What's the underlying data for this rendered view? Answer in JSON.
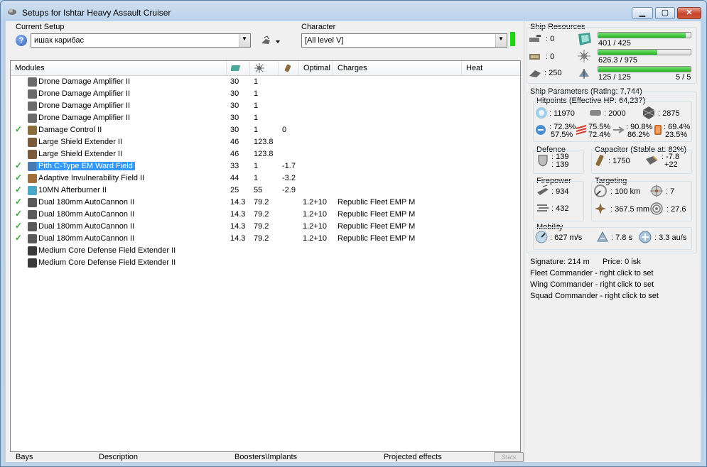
{
  "window": {
    "title": "Setups for Ishtar Heavy Assault Cruiser",
    "min_glyph": "▁",
    "max_glyph": "▢",
    "close_glyph": "✕"
  },
  "setup": {
    "label": "Current Setup",
    "value": "ишак карибас",
    "help_glyph": "?"
  },
  "character": {
    "label": "Character",
    "value": "[All level V]"
  },
  "modules": {
    "headers": {
      "modules": "Modules",
      "optimal": "Optimal",
      "charges": "Charges",
      "heat": "Heat"
    },
    "rows": [
      {
        "checked": false,
        "icon": "drone-damage-amplifier-icon",
        "name": "Drone Damage Amplifier II",
        "cpu": "30",
        "pg": "1",
        "cap": "",
        "optimal": "",
        "charges": "",
        "selected": false
      },
      {
        "checked": false,
        "icon": "drone-damage-amplifier-icon",
        "name": "Drone Damage Amplifier II",
        "cpu": "30",
        "pg": "1",
        "cap": "",
        "optimal": "",
        "charges": "",
        "selected": false
      },
      {
        "checked": false,
        "icon": "drone-damage-amplifier-icon",
        "name": "Drone Damage Amplifier II",
        "cpu": "30",
        "pg": "1",
        "cap": "",
        "optimal": "",
        "charges": "",
        "selected": false
      },
      {
        "checked": false,
        "icon": "drone-damage-amplifier-icon",
        "name": "Drone Damage Amplifier II",
        "cpu": "30",
        "pg": "1",
        "cap": "",
        "optimal": "",
        "charges": "",
        "selected": false
      },
      {
        "checked": true,
        "icon": "damage-control-icon",
        "name": "Damage Control II",
        "cpu": "30",
        "pg": "1",
        "cap": "0",
        "optimal": "",
        "charges": "",
        "selected": false
      },
      {
        "checked": false,
        "icon": "shield-extender-icon",
        "name": "Large Shield Extender II",
        "cpu": "46",
        "pg": "123.8",
        "cap": "",
        "optimal": "",
        "charges": "",
        "selected": false
      },
      {
        "checked": false,
        "icon": "shield-extender-icon",
        "name": "Large Shield Extender II",
        "cpu": "46",
        "pg": "123.8",
        "cap": "",
        "optimal": "",
        "charges": "",
        "selected": false
      },
      {
        "checked": true,
        "icon": "ward-field-icon",
        "name": "Pith C-Type EM Ward Field",
        "cpu": "33",
        "pg": "1",
        "cap": "-1.7",
        "optimal": "",
        "charges": "",
        "selected": true
      },
      {
        "checked": true,
        "icon": "invulnerability-field-icon",
        "name": "Adaptive Invulnerability Field II",
        "cpu": "44",
        "pg": "1",
        "cap": "-3.2",
        "optimal": "",
        "charges": "",
        "selected": false
      },
      {
        "checked": true,
        "icon": "afterburner-icon",
        "name": "10MN Afterburner II",
        "cpu": "25",
        "pg": "55",
        "cap": "-2.9",
        "optimal": "",
        "charges": "",
        "selected": false
      },
      {
        "checked": true,
        "icon": "autocannon-icon",
        "name": "Dual 180mm AutoCannon II",
        "cpu": "14.3",
        "pg": "79.2",
        "cap": "",
        "optimal": "1.2+10",
        "charges": "Republic Fleet EMP M",
        "selected": false
      },
      {
        "checked": true,
        "icon": "autocannon-icon",
        "name": "Dual 180mm AutoCannon II",
        "cpu": "14.3",
        "pg": "79.2",
        "cap": "",
        "optimal": "1.2+10",
        "charges": "Republic Fleet EMP M",
        "selected": false
      },
      {
        "checked": true,
        "icon": "autocannon-icon",
        "name": "Dual 180mm AutoCannon II",
        "cpu": "14.3",
        "pg": "79.2",
        "cap": "",
        "optimal": "1.2+10",
        "charges": "Republic Fleet EMP M",
        "selected": false
      },
      {
        "checked": true,
        "icon": "autocannon-icon",
        "name": "Dual 180mm AutoCannon II",
        "cpu": "14.3",
        "pg": "79.2",
        "cap": "",
        "optimal": "1.2+10",
        "charges": "Republic Fleet EMP M",
        "selected": false
      },
      {
        "checked": false,
        "icon": "rig-icon",
        "name": "Medium Core Defense Field Extender II",
        "cpu": "",
        "pg": "",
        "cap": "",
        "optimal": "",
        "charges": "",
        "selected": false
      },
      {
        "checked": false,
        "icon": "rig-icon",
        "name": "Medium Core Defense Field Extender II",
        "cpu": "",
        "pg": "",
        "cap": "",
        "optimal": "",
        "charges": "",
        "selected": false
      }
    ]
  },
  "bottom_tabs": {
    "bays": "Bays",
    "description": "Description",
    "boosters": "Boosters\\Implants",
    "projected": "Projected effects",
    "stats": "Stats"
  },
  "resources": {
    "title": "Ship Resources",
    "turret_slots": ": 0",
    "launcher_slots": ": 0",
    "drone_bay": ": 250",
    "cpu": {
      "text": "401 / 425",
      "fraction": 0.944
    },
    "powergrid": {
      "text": "626.3 / 975",
      "fraction": 0.642
    },
    "bandwidth": {
      "text": "125 / 125",
      "fraction": 1.0
    },
    "drones_active": "5 / 5"
  },
  "params": {
    "title": "Ship Parameters (Rating: 7,744)",
    "hitpoints": {
      "title": "Hitpoints (Effective HP: 64,237)",
      "shield_hp": ": 11970",
      "armor_hp": ": 2000",
      "hull_hp": ": 2875",
      "em": [
        ": 72.3%",
        "57.5%"
      ],
      "thermal": [
        "75.5%",
        "72.4%"
      ],
      "kinetic": [
        ": 90.8%",
        "86.2%"
      ],
      "explosive": [
        ": 69.4%",
        "23.5%"
      ]
    },
    "defence": {
      "title": "Defence",
      "a": ": 139",
      "b": ": 139"
    },
    "capacitor": {
      "title": "Capacitor (Stable at: 82%)",
      "amount": ": 1750",
      "delta": ": -7.8",
      "recharge": "+22"
    },
    "firepower": {
      "title": "Firepower",
      "dps": ": 934",
      "volley": ": 432"
    },
    "targeting": {
      "title": "Targeting",
      "range": ": 100 km",
      "targets": ": 7",
      "scan_res": ": 367.5 mm",
      "sensor": ": 27.6"
    },
    "mobility": {
      "title": "Mobility",
      "speed": ": 627 m/s",
      "align": ": 7.8 s",
      "warp": ": 3.3 au/s"
    }
  },
  "info": {
    "signature": "Signature: 214 m",
    "price": "Price: 0 isk",
    "fleet": "Fleet Commander - right click to set",
    "wing": "Wing Commander - right click to set",
    "squad": "Squad Commander - right click to set"
  },
  "colors": {
    "selection": "#3399ff",
    "check": "#3aa43a",
    "bar_fill": "#22b51f",
    "indicator": "#22d31e"
  }
}
